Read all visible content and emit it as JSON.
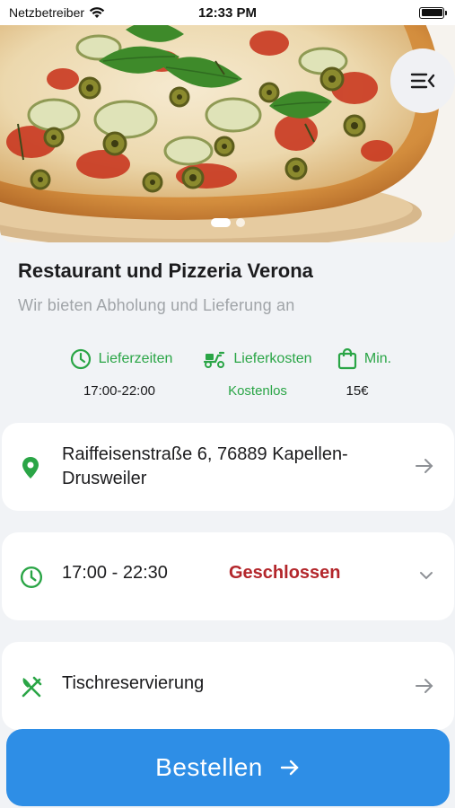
{
  "status_bar": {
    "carrier": "Netzbetreiber",
    "time": "12:33 PM"
  },
  "hero": {
    "image_subject": "pizza",
    "carousel_count": 2,
    "carousel_active": 1
  },
  "restaurant": {
    "name": "Restaurant und Pizzeria Verona",
    "tagline": "Wir bieten Abholung und Lieferung an"
  },
  "info": {
    "delivery_times_label": "Lieferzeiten",
    "delivery_times_value": "17:00-22:00",
    "delivery_cost_label": "Lieferkosten",
    "delivery_cost_value": "Kostenlos",
    "minimum_label": "Min.",
    "minimum_value": "15€"
  },
  "address": {
    "text": "Raiffeisenstraße 6, 76889 Kapellen-Drusweiler"
  },
  "hours": {
    "range": "17:00 - 22:30",
    "status": "Geschlossen"
  },
  "reservation": {
    "label": "Tischreservierung"
  },
  "order_button": {
    "label": "Bestellen"
  },
  "colors": {
    "accent_green": "#2aa546",
    "closed_red": "#b3262b",
    "primary_blue": "#2e8ee6",
    "background": "#f1f3f6"
  }
}
